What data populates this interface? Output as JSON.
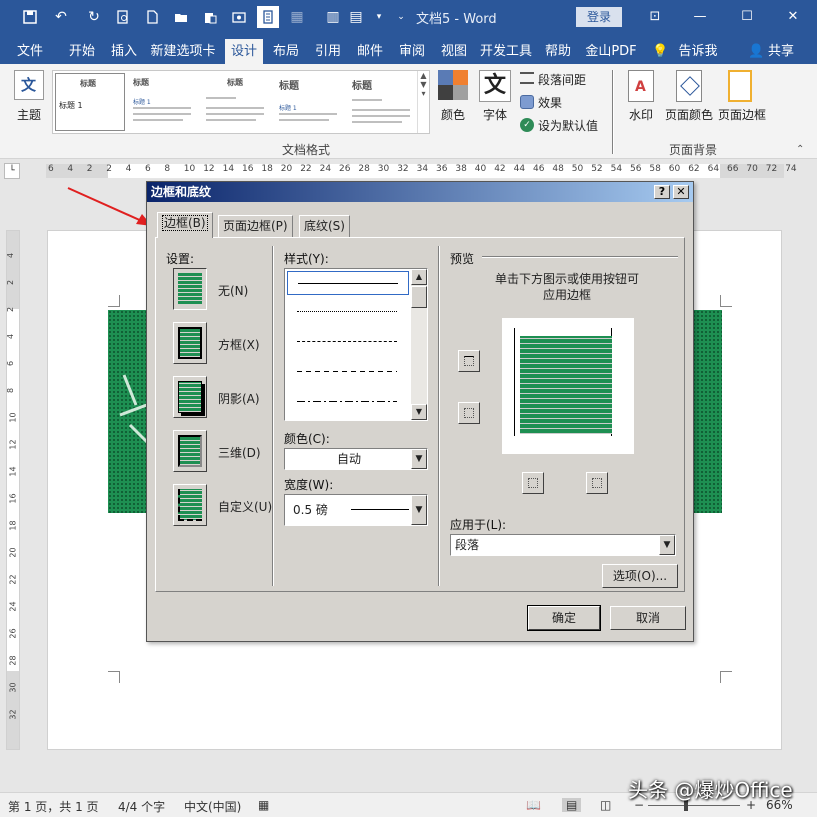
{
  "titlebar": {
    "doc_title": "文档5  -  Word",
    "login": "登录",
    "quick_access": [
      "save-icon",
      "undo-icon",
      "redo-icon",
      "print-preview-icon",
      "new-doc-icon",
      "open-icon",
      "paste-icon",
      "screenshot-icon",
      "document-icon",
      "table-icon",
      "columns-icon"
    ]
  },
  "tabs": [
    "文件",
    "开始",
    "插入",
    "新建选项卡",
    "设计",
    "布局",
    "引用",
    "邮件",
    "审阅",
    "视图",
    "开发工具",
    "帮助",
    "金山PDF",
    "告诉我",
    "共享"
  ],
  "active_tab": "设计",
  "ribbon": {
    "theme_label": "主题",
    "gallery_items": [
      {
        "title": "标题",
        "sub": "标题 1"
      },
      {
        "title": "标题",
        "sub": "标题 1"
      },
      {
        "title": "标题",
        "sub": ""
      },
      {
        "title": "标题",
        "sub": "标题 1"
      },
      {
        "title": "标题",
        "sub": ""
      }
    ],
    "colors_label": "颜色",
    "fonts_label": "字体",
    "para_spacing": "段落间距",
    "effects": "效果",
    "set_default": "设为默认值",
    "group_doc_format": "文档格式",
    "watermark": "水印",
    "page_color": "页面颜色",
    "page_border": "页面边框",
    "group_page_bg": "页面背景",
    "theme_icon_text": "文"
  },
  "ruler_ticks": [
    "6",
    "4",
    "2",
    "2",
    "4",
    "6",
    "8",
    "10",
    "12",
    "14",
    "16",
    "18",
    "20",
    "22",
    "24",
    "26",
    "28",
    "30",
    "32",
    "34",
    "36",
    "38",
    "40",
    "42",
    "44",
    "46",
    "48",
    "50",
    "52",
    "54",
    "56",
    "58",
    "60",
    "62",
    "64",
    "66",
    "70",
    "72",
    "74"
  ],
  "vruler_ticks": [
    "4",
    "2",
    "2",
    "4",
    "6",
    "8",
    "10",
    "12",
    "14",
    "16",
    "18",
    "20",
    "22",
    "24",
    "26",
    "28",
    "30",
    "32"
  ],
  "dialog": {
    "title": "边框和底纹",
    "help": "?",
    "close": "✕",
    "tabs": [
      "边框(B)",
      "页面边框(P)",
      "底纹(S)"
    ],
    "settings_label": "设置:",
    "settings": [
      "无(N)",
      "方框(X)",
      "阴影(A)",
      "三维(D)",
      "自定义(U)"
    ],
    "style_label": "样式(Y):",
    "color_label": "颜色(C):",
    "color_value": "自动",
    "width_label": "宽度(W):",
    "width_value": "0.5 磅",
    "preview_label": "预览",
    "preview_hint": "单击下方图示或使用按钮可应用边框",
    "apply_label": "应用于(L):",
    "apply_value": "段落",
    "options_btn": "选项(O)...",
    "ok_btn": "确定",
    "cancel_btn": "取消"
  },
  "status": {
    "page": "第 1 页，共 1 页",
    "words": "4/4 个字",
    "lang": "中文(中国)",
    "zoom": "66%"
  },
  "watermark": "头条 @爆炒Office",
  "colors": {
    "accent": "#2b579a",
    "green": "#1e8f52",
    "arrow": "#e02020"
  }
}
